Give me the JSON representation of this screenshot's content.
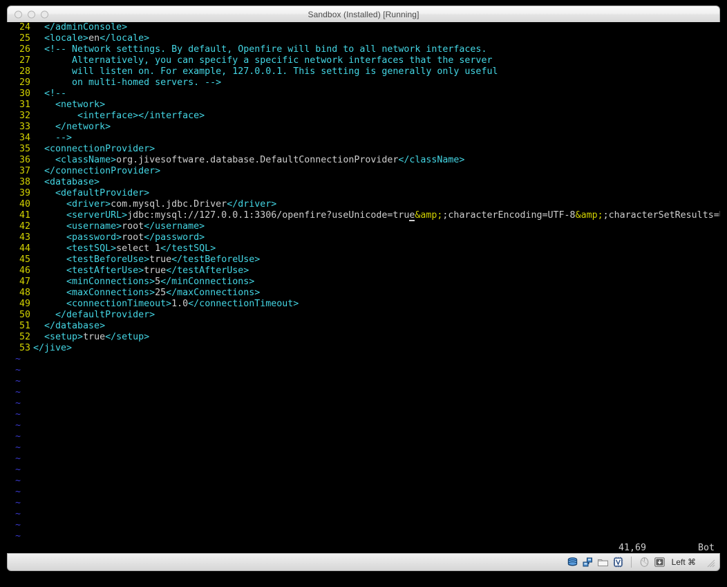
{
  "window": {
    "title": "Sandbox (Installed) [Running]",
    "traffic_lights": [
      "close-button",
      "minimize-button",
      "zoom-button"
    ]
  },
  "editor": {
    "name": "vim",
    "colors": {
      "background": "#000000",
      "line_number": "#d3d300",
      "tag": "#44d6e4",
      "text": "#cfcfcf",
      "comment": "#44d6e4",
      "entity": "#d3d300",
      "tilde": "#3b3bd4"
    },
    "lines": [
      {
        "num": "24",
        "segments": [
          {
            "t": "tag",
            "s": "  </adminConsole>"
          }
        ]
      },
      {
        "num": "25",
        "segments": [
          {
            "t": "tag",
            "s": "  <locale>"
          },
          {
            "t": "txt",
            "s": "en"
          },
          {
            "t": "tag",
            "s": "</locale>"
          }
        ]
      },
      {
        "num": "26",
        "segments": [
          {
            "t": "comment",
            "s": "  <!-- Network settings. By default, Openfire will bind to all network interfaces."
          }
        ]
      },
      {
        "num": "27",
        "segments": [
          {
            "t": "comment",
            "s": "       Alternatively, you can specify a specific network interfaces that the server"
          }
        ]
      },
      {
        "num": "28",
        "segments": [
          {
            "t": "comment",
            "s": "       will listen on. For example, 127.0.0.1. This setting is generally only useful"
          }
        ]
      },
      {
        "num": "29",
        "segments": [
          {
            "t": "comment",
            "s": "       on multi-homed servers. -->"
          }
        ]
      },
      {
        "num": "30",
        "segments": [
          {
            "t": "comment",
            "s": "  <!--"
          }
        ]
      },
      {
        "num": "31",
        "segments": [
          {
            "t": "comment",
            "s": "    <network>"
          }
        ]
      },
      {
        "num": "32",
        "segments": [
          {
            "t": "comment",
            "s": "        <interface></interface>"
          }
        ]
      },
      {
        "num": "33",
        "segments": [
          {
            "t": "comment",
            "s": "    </network>"
          }
        ]
      },
      {
        "num": "34",
        "segments": [
          {
            "t": "comment",
            "s": "    -->"
          }
        ]
      },
      {
        "num": "35",
        "segments": [
          {
            "t": "tag",
            "s": "  <connectionProvider>"
          }
        ]
      },
      {
        "num": "36",
        "segments": [
          {
            "t": "tag",
            "s": "    <className>"
          },
          {
            "t": "txt",
            "s": "org.jivesoftware.database.DefaultConnectionProvider"
          },
          {
            "t": "tag",
            "s": "</className>"
          }
        ]
      },
      {
        "num": "37",
        "segments": [
          {
            "t": "tag",
            "s": "  </connectionProvider>"
          }
        ]
      },
      {
        "num": "38",
        "segments": [
          {
            "t": "tag",
            "s": "  <database>"
          }
        ]
      },
      {
        "num": "39",
        "segments": [
          {
            "t": "tag",
            "s": "    <defaultProvider>"
          }
        ]
      },
      {
        "num": "40",
        "segments": [
          {
            "t": "tag",
            "s": "      <driver>"
          },
          {
            "t": "txt",
            "s": "com.mysql.jdbc.Driver"
          },
          {
            "t": "tag",
            "s": "</driver>"
          }
        ]
      },
      {
        "num": "41",
        "segments": [
          {
            "t": "tag",
            "s": "      <serverURL>"
          },
          {
            "t": "txt",
            "s": "jdbc:mysql://127.0.0.1:3306/openfire?useUnicode=tru"
          },
          {
            "t": "cursor",
            "s": "e"
          },
          {
            "t": "entity",
            "s": "&amp;"
          },
          {
            "t": "txt",
            "s": ";characterEncoding=UTF-8"
          },
          {
            "t": "entity",
            "s": "&amp;"
          },
          {
            "t": "txt",
            "s": ";characterSetResults=UT"
          }
        ]
      },
      {
        "num": "42",
        "segments": [
          {
            "t": "tag",
            "s": "      <username>"
          },
          {
            "t": "txt",
            "s": "root"
          },
          {
            "t": "tag",
            "s": "</username>"
          }
        ]
      },
      {
        "num": "43",
        "segments": [
          {
            "t": "tag",
            "s": "      <password>"
          },
          {
            "t": "txt",
            "s": "root"
          },
          {
            "t": "tag",
            "s": "</password>"
          }
        ]
      },
      {
        "num": "44",
        "segments": [
          {
            "t": "tag",
            "s": "      <testSQL>"
          },
          {
            "t": "txt",
            "s": "select 1"
          },
          {
            "t": "tag",
            "s": "</testSQL>"
          }
        ]
      },
      {
        "num": "45",
        "segments": [
          {
            "t": "tag",
            "s": "      <testBeforeUse>"
          },
          {
            "t": "txt",
            "s": "true"
          },
          {
            "t": "tag",
            "s": "</testBeforeUse>"
          }
        ]
      },
      {
        "num": "46",
        "segments": [
          {
            "t": "tag",
            "s": "      <testAfterUse>"
          },
          {
            "t": "txt",
            "s": "true"
          },
          {
            "t": "tag",
            "s": "</testAfterUse>"
          }
        ]
      },
      {
        "num": "47",
        "segments": [
          {
            "t": "tag",
            "s": "      <minConnections>"
          },
          {
            "t": "txt",
            "s": "5"
          },
          {
            "t": "tag",
            "s": "</minConnections>"
          }
        ]
      },
      {
        "num": "48",
        "segments": [
          {
            "t": "tag",
            "s": "      <maxConnections>"
          },
          {
            "t": "txt",
            "s": "25"
          },
          {
            "t": "tag",
            "s": "</maxConnections>"
          }
        ]
      },
      {
        "num": "49",
        "segments": [
          {
            "t": "tag",
            "s": "      <connectionTimeout>"
          },
          {
            "t": "txt",
            "s": "1.0"
          },
          {
            "t": "tag",
            "s": "</connectionTimeout>"
          }
        ]
      },
      {
        "num": "50",
        "segments": [
          {
            "t": "tag",
            "s": "    </defaultProvider>"
          }
        ]
      },
      {
        "num": "51",
        "segments": [
          {
            "t": "tag",
            "s": "  </database>"
          }
        ]
      },
      {
        "num": "52",
        "segments": [
          {
            "t": "tag",
            "s": "  <setup>"
          },
          {
            "t": "txt",
            "s": "true"
          },
          {
            "t": "tag",
            "s": "</setup>"
          }
        ]
      },
      {
        "num": "53",
        "segments": [
          {
            "t": "tag",
            "s": "</jive>"
          }
        ]
      }
    ],
    "tilde_count": 17,
    "tilde_glyph": "~",
    "status": {
      "ruler": "41,69",
      "scroll_position": "Bot"
    }
  },
  "statusbar": {
    "icons": [
      {
        "name": "hard-disk-icon",
        "title": "hard-disk"
      },
      {
        "name": "network-icon",
        "title": "network-adapters"
      },
      {
        "name": "shared-folder-icon",
        "title": "shared-folders"
      },
      {
        "name": "virtualization-icon",
        "title": "virtualization"
      },
      {
        "name": "mouse-icon",
        "title": "mouse-integration"
      },
      {
        "name": "host-key-icon",
        "title": "host-key"
      }
    ],
    "host_key_label": "Left ⌘"
  }
}
